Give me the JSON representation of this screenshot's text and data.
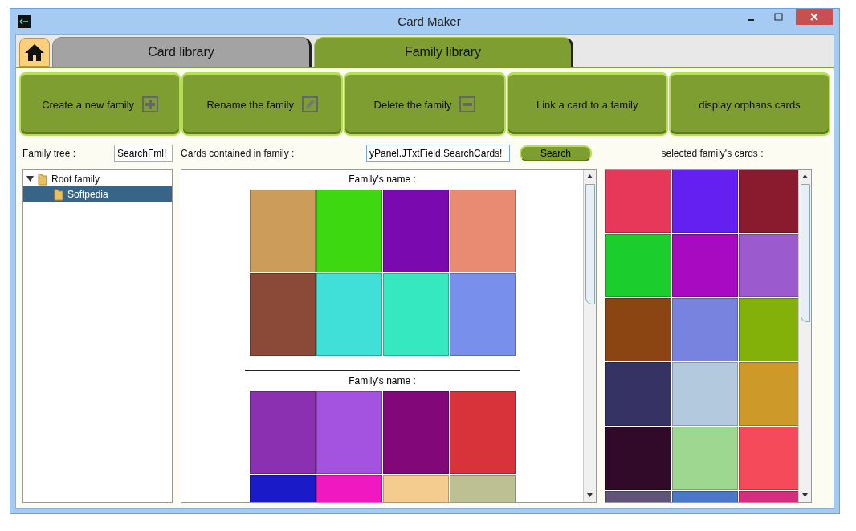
{
  "window": {
    "title": "Card Maker"
  },
  "tabs": [
    {
      "label": "Card library",
      "selected": false
    },
    {
      "label": "Family library",
      "selected": true
    }
  ],
  "toolbar": [
    {
      "label": "Create a new family"
    },
    {
      "label": "Rename the family"
    },
    {
      "label": "Delete the family"
    },
    {
      "label": "Link a card to a family"
    },
    {
      "label": "display orphans cards"
    }
  ],
  "family_tree": {
    "label": "Family tree :",
    "search_value": "SearchFml!",
    "items": [
      {
        "label": "Root family",
        "expanded": true,
        "selected": false,
        "children": [
          {
            "label": "Softpedia",
            "selected": true
          }
        ]
      }
    ]
  },
  "cards_panel": {
    "label": "Cards contained in family :",
    "search_value": "yPanel.JTxtField.SearchCards!",
    "search_button": "Search",
    "groups": [
      {
        "title": "Family's name :",
        "cards": [
          {
            "color": "#cc9d5a"
          },
          {
            "color": "#3ed810"
          },
          {
            "color": "#7a0ab0"
          },
          {
            "color": "#e98a73"
          },
          {
            "color": "#8b4a38"
          },
          {
            "color": "#40e0d8"
          },
          {
            "color": "#36e8c0"
          },
          {
            "color": "#7890ec"
          }
        ]
      },
      {
        "title": "Family's name :",
        "cards": [
          {
            "color": "#8a30b0"
          },
          {
            "color": "#a452e0"
          },
          {
            "color": "#82087a"
          },
          {
            "color": "#d8333a"
          },
          {
            "color": "#1a1ac8"
          },
          {
            "color": "#f018c0"
          },
          {
            "color": "#f5cc90"
          },
          {
            "color": "#bcc092"
          }
        ]
      }
    ]
  },
  "selected_cards": {
    "label": "selected family's cards :",
    "cards": [
      {
        "color": "#e8385a"
      },
      {
        "color": "#6420f0"
      },
      {
        "color": "#8a1a2e"
      },
      {
        "color": "#1ccd2e"
      },
      {
        "color": "#a70ac0"
      },
      {
        "color": "#9c5acf"
      },
      {
        "color": "#8b4513"
      },
      {
        "color": "#7883e0"
      },
      {
        "color": "#84b00a"
      },
      {
        "color": "#363364"
      },
      {
        "color": "#b3cade"
      },
      {
        "color": "#cd9a2a"
      },
      {
        "color": "#300a28"
      },
      {
        "color": "#9ed890"
      },
      {
        "color": "#f54a5a"
      },
      {
        "color": "#5f5478"
      },
      {
        "color": "#4a78c8"
      },
      {
        "color": "#d42e7e"
      }
    ]
  }
}
